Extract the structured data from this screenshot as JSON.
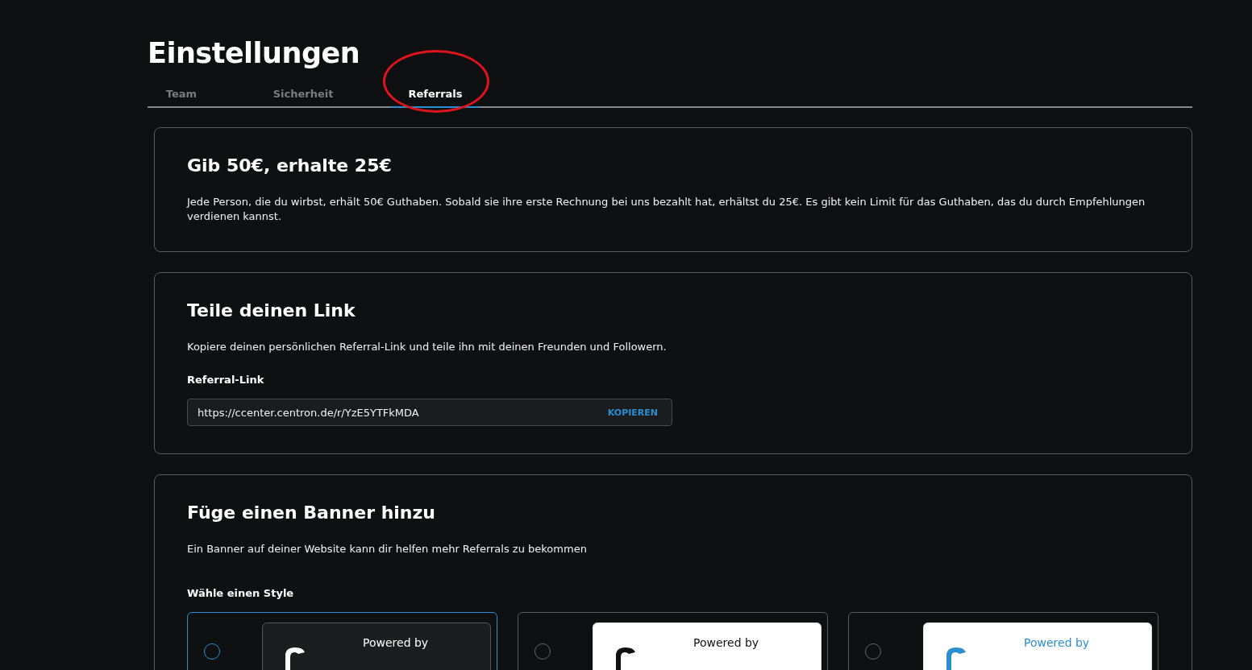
{
  "page": {
    "title": "Einstellungen"
  },
  "tabs": [
    {
      "label": "Team",
      "selected": false
    },
    {
      "label": "Sicherheit",
      "selected": false
    },
    {
      "label": "Referrals",
      "selected": true,
      "highlighted": true
    }
  ],
  "reward_card": {
    "title": "Gib 50€, erhalte 25€",
    "text": "Jede Person, die du wirbst, erhält 50€ Guthaben. Sobald sie ihre erste Rechnung bei uns bezahlt hat, erhältst du 25€. Es gibt kein Limit für das Guthaben, das du durch Empfehlungen verdienen kannst."
  },
  "link_card": {
    "title": "Teile deinen Link",
    "text": "Kopiere deinen persönlichen Referral-Link und teile ihn mit deinen Freunden und Followern.",
    "field_label": "Referral-Link",
    "value": "https://ccenter.centron.de/r/YzE5YTFkMDA",
    "copy_button": "KOPIEREN"
  },
  "banner_card": {
    "title": "Füge einen Banner hinzu",
    "text": "Ein Banner auf deiner Website kann dir helfen mehr Referrals zu bekommen",
    "style_label": "Wähle einen Style",
    "styles": [
      {
        "kind": "dark",
        "selected": true,
        "caption": "Powered by"
      },
      {
        "kind": "light",
        "selected": false,
        "caption": "Powered by"
      },
      {
        "kind": "accent",
        "selected": false,
        "caption": "Powered by"
      }
    ]
  }
}
